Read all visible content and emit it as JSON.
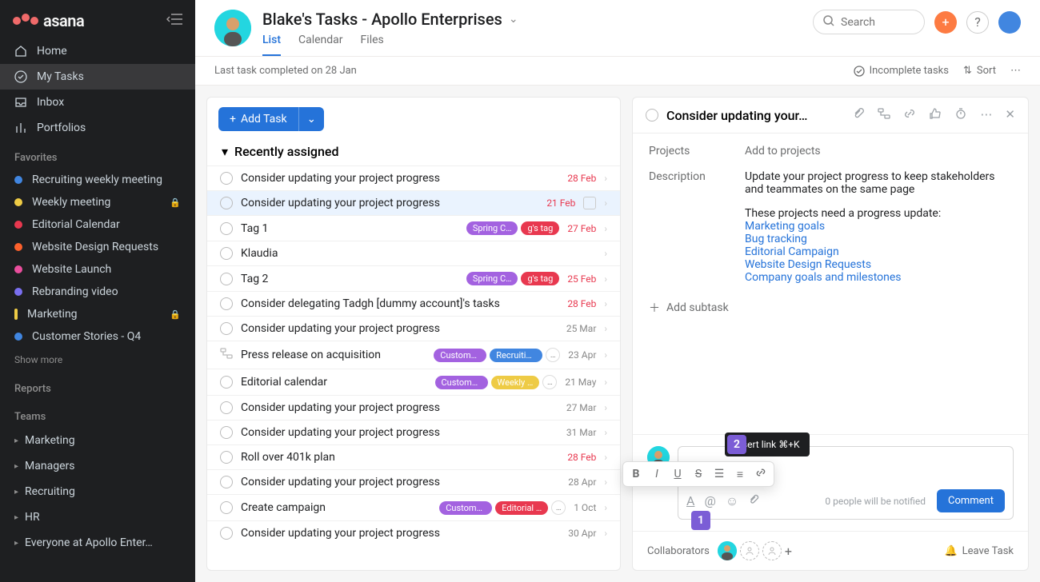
{
  "app": {
    "name": "asana"
  },
  "sidebar": {
    "nav": {
      "home": "Home",
      "mytasks": "My Tasks",
      "inbox": "Inbox",
      "portfolios": "Portfolios"
    },
    "favorites_label": "Favorites",
    "favorites": [
      {
        "label": "Recruiting weekly meeting",
        "color": "#4186e0"
      },
      {
        "label": "Weekly meeting",
        "color": "#eecb45",
        "locked": true
      },
      {
        "label": "Editorial Calendar",
        "color": "#e8384f"
      },
      {
        "label": "Website Design Requests",
        "color": "#fd612c"
      },
      {
        "label": "Website Launch",
        "color": "#ea4e9d"
      },
      {
        "label": "Rebranding video",
        "color": "#7a6ff0"
      },
      {
        "label": "Marketing",
        "color": "#eecb45",
        "bar": true,
        "locked": true
      },
      {
        "label": "Customer Stories - Q4",
        "color": "#4186e0"
      }
    ],
    "show_more": "Show more",
    "reports_label": "Reports",
    "teams_label": "Teams",
    "teams": [
      "Marketing",
      "Managers",
      "Recruiting",
      "HR",
      "Everyone at Apollo Enter…"
    ]
  },
  "header": {
    "title": "Blake's Tasks - Apollo Enterprises",
    "tabs": {
      "list": "List",
      "calendar": "Calendar",
      "files": "Files"
    },
    "search_placeholder": "Search"
  },
  "subbar": {
    "status": "Last task completed on 28 Jan",
    "filter": "Incomplete tasks",
    "sort": "Sort"
  },
  "list": {
    "add_task": "Add Task",
    "section": "Recently assigned",
    "tasks": [
      {
        "title": "Consider updating your project progress",
        "due": "28 Feb",
        "red": true
      },
      {
        "title": "Consider updating your project progress",
        "due": "21 Feb",
        "red": true,
        "selected": true,
        "cal": true
      },
      {
        "title": "Tag 1",
        "due": "27 Feb",
        "red": true,
        "pills": [
          {
            "t": "Spring C…",
            "c": "#a362e0"
          },
          {
            "t": "g's tag",
            "c": "#e8384f"
          }
        ]
      },
      {
        "title": "Klaudia"
      },
      {
        "title": "Tag 2",
        "due": "25 Feb",
        "red": true,
        "pills": [
          {
            "t": "Spring C…",
            "c": "#a362e0"
          },
          {
            "t": "g's tag",
            "c": "#e8384f"
          }
        ]
      },
      {
        "title": "Consider delegating Tadgh [dummy account]'s tasks",
        "due": "28 Feb",
        "red": true
      },
      {
        "title": "Consider updating your project progress",
        "due": "25 Mar"
      },
      {
        "title": "Press release on acquisition",
        "due": "23 Apr",
        "sub": true,
        "pills": [
          {
            "t": "Custome…",
            "c": "#a362e0"
          },
          {
            "t": "Recruitin…",
            "c": "#4186e0"
          }
        ],
        "more": true
      },
      {
        "title": "Editorial calendar",
        "due": "21 May",
        "pills": [
          {
            "t": "Custome…",
            "c": "#a362e0"
          },
          {
            "t": "Weekly …",
            "c": "#eecb45"
          }
        ],
        "more": true
      },
      {
        "title": "Consider updating your project progress",
        "due": "27 Mar"
      },
      {
        "title": "Consider updating your project progress",
        "due": "31 Mar"
      },
      {
        "title": "Roll over 401k plan",
        "due": "28 Feb",
        "red": true
      },
      {
        "title": "Consider updating your project progress",
        "due": "28 Apr"
      },
      {
        "title": "Create campaign",
        "due": "1 Oct",
        "pills": [
          {
            "t": "Custome…",
            "c": "#a362e0"
          },
          {
            "t": "Editorial …",
            "c": "#e8384f"
          }
        ],
        "more": true
      },
      {
        "title": "Consider updating your project progress",
        "due": "30 Apr"
      }
    ]
  },
  "detail": {
    "title": "Consider updating your…",
    "projects_label": "Projects",
    "projects_val": "Add to projects",
    "desc_label": "Description",
    "desc_intro": "Update your project progress to keep stakeholders and teammates on the same page",
    "desc_need": "These projects need a progress update:",
    "links": [
      "Marketing goals",
      "Bug tracking",
      "Editorial Campaign",
      "Website Design Requests",
      "Company goals and milestones"
    ],
    "add_subtask": "Add subtask",
    "tooltip": "Insert link ⌘+K",
    "notify": "0 people will be notified",
    "comment_btn": "Comment",
    "collaborators": "Collaborators",
    "leave": "Leave Task",
    "callout1": "1",
    "callout2": "2"
  }
}
